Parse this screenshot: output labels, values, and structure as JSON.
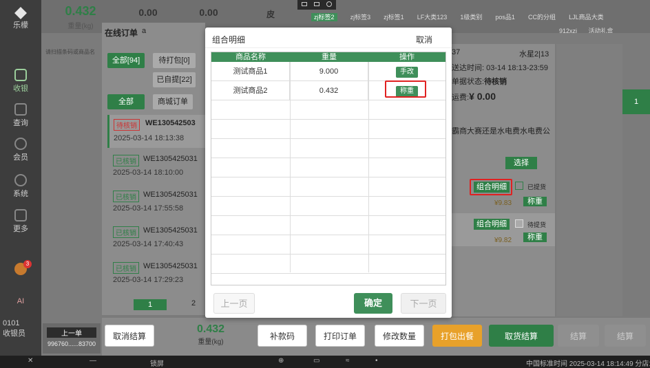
{
  "sidebar": {
    "logo_label": "乐檬",
    "items": [
      {
        "label": "收银",
        "icon": "cash-register-icon"
      },
      {
        "label": "查询",
        "icon": "query-icon"
      },
      {
        "label": "会员",
        "icon": "member-icon"
      },
      {
        "label": "系统",
        "icon": "settings-icon"
      },
      {
        "label": "更多",
        "icon": "more-icon"
      }
    ],
    "ai_label": "AI",
    "user_id": "0101",
    "user_role": "收银员",
    "badge_count": "3"
  },
  "header": {
    "weight_value": "0.432",
    "weight_label": "重量(kg)",
    "tare_value": "0.00",
    "tare_value2": "0.00",
    "pi_label": "皮",
    "tabs": [
      "zj标签2",
      "zj标签3",
      "zj标签1",
      "LF大类123",
      "1级类别",
      "pos品1",
      "CC的分组",
      "LJL商品大类"
    ],
    "sub_tabs": [
      "912xzj",
      "活动礼盒"
    ]
  },
  "online_order": {
    "title": "在线订单",
    "search_value": "a",
    "input_placeholder": "请扫描条码或商品名",
    "filter_all": "全部[94]",
    "filter_pack": "待打包[0]",
    "filter_picked": "已自提[22]",
    "type_all": "全部",
    "type_mall": "商城订单",
    "orders": [
      {
        "status": "待核销",
        "no": "WE130542503",
        "time": "2025-03-14 18:13:38"
      },
      {
        "status": "已核销",
        "no": "WE1305425031",
        "time": "2025-03-14 18:10:00"
      },
      {
        "status": "已核销",
        "no": "WE1305425031",
        "time": "2025-03-14 17:55:58"
      },
      {
        "status": "已核销",
        "no": "WE1305425031",
        "time": "2025-03-14 17:40:43"
      },
      {
        "status": "已核销",
        "no": "WE1305425031",
        "time": "2025-03-14 17:29:23"
      }
    ],
    "page_1": "1",
    "page_2": "2"
  },
  "detail": {
    "num_suffix": "37",
    "store": "水星2|13",
    "deliver_time": "送达时间: 03-14 18:13-23:59",
    "doc_status_label": "单据状态:",
    "doc_status": "待核销",
    "freight_label": "运费:",
    "freight": "¥ 0.00",
    "note": "霸商大赛还是水电费水电费公",
    "select_btn": "选择",
    "items": [
      {
        "combo": "组合明细",
        "picked": "已提货",
        "price": "¥9.83",
        "weigh": "称重"
      },
      {
        "combo": "组合明细",
        "picked": "待提货",
        "price": "¥9.82",
        "weigh": "称重"
      }
    ]
  },
  "modal": {
    "title": "组合明细",
    "cancel": "取消",
    "columns": [
      "商品名称",
      "重量",
      "操作"
    ],
    "rows": [
      {
        "name": "测试商品1",
        "weight": "9.000",
        "action": "手改"
      },
      {
        "name": "测试商品2",
        "weight": "0.432",
        "action": "称重"
      }
    ],
    "prev": "上一页",
    "confirm": "确定",
    "next": "下一页"
  },
  "footer": {
    "shift_label": "上一单",
    "shift_no": "996760......83700",
    "cancel_settle": "取消结算",
    "weight_value": "0.432",
    "weight_label": "重量(kg)",
    "pay_code": "补款码",
    "print_order": "打印订单",
    "modify_qty": "修改数量",
    "pack_out": "打包出餐",
    "pickup_settle": "取货结算",
    "settle1": "结算",
    "settle2": "结算"
  },
  "taskbar": {
    "lock": "锁屏",
    "clock": "中国标准时间 2025-03-14 18:14:49 分店1"
  },
  "colors": {
    "brand_green": "#3f8f5a",
    "highlight_red": "#e02020",
    "warn_orange": "#e8a12a"
  }
}
